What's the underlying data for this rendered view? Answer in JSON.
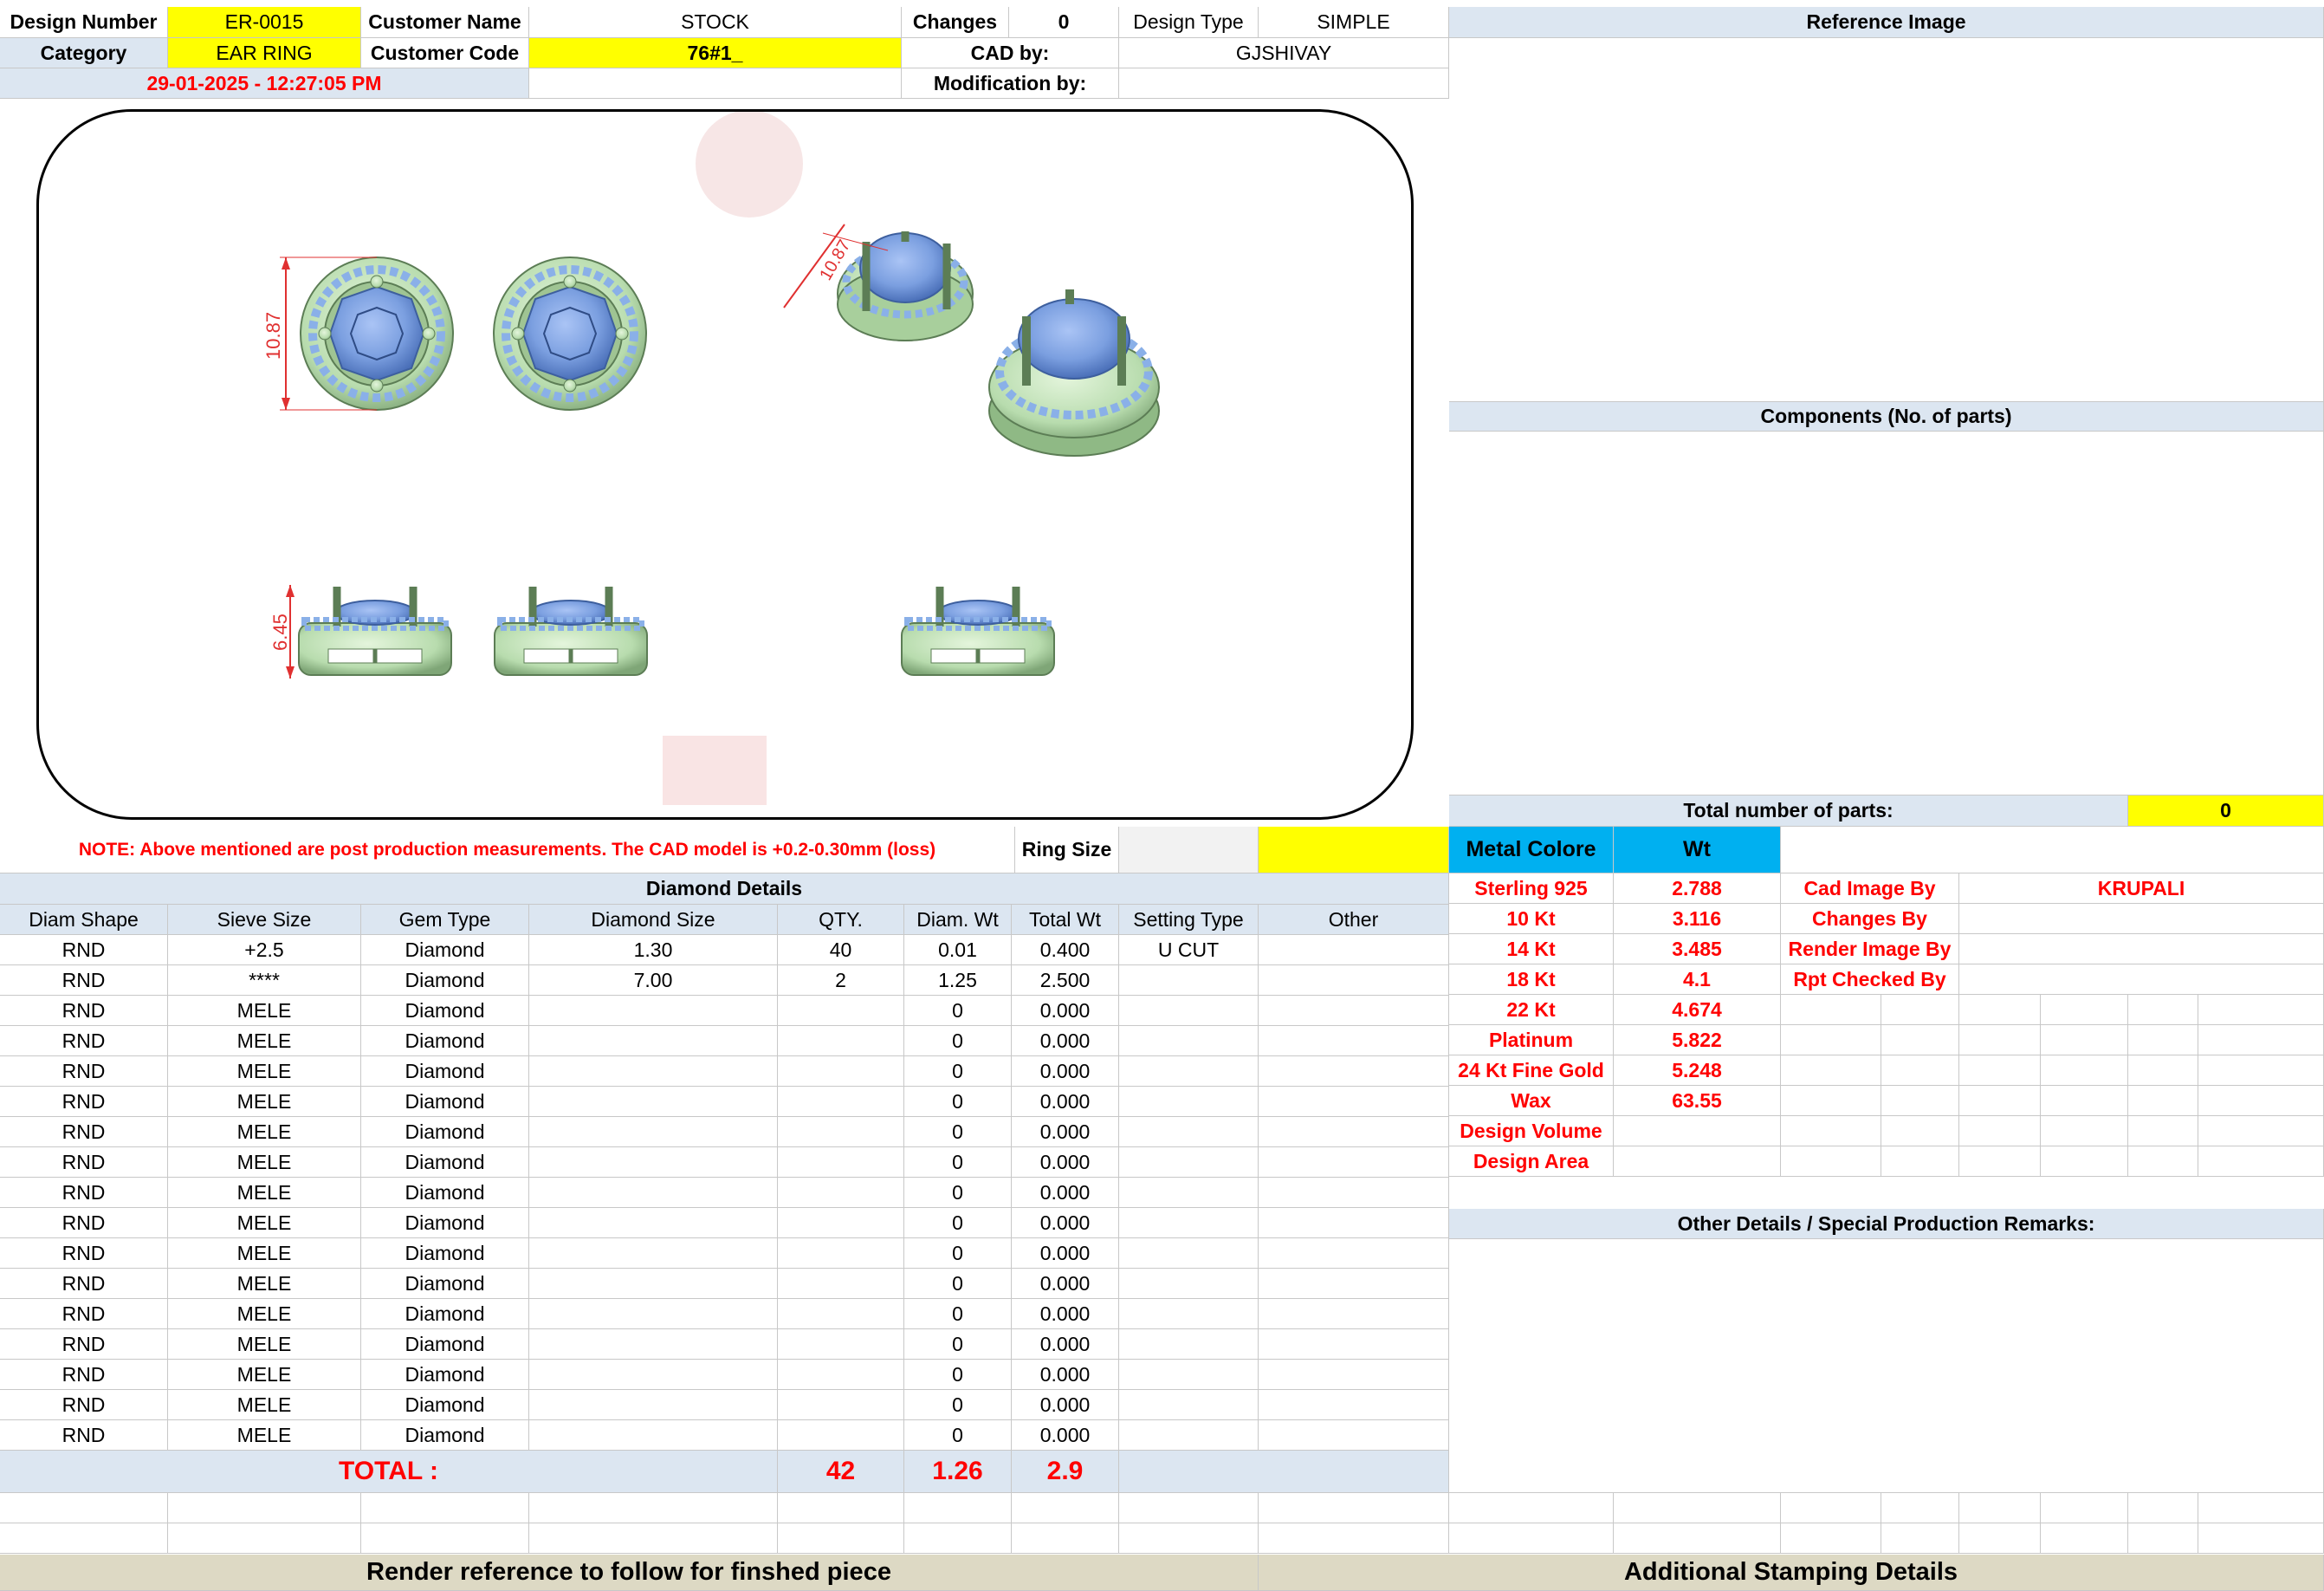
{
  "header": {
    "design_number_label": "Design Number",
    "design_number": "ER-0015",
    "customer_name_label": "Customer Name",
    "customer_name": "STOCK",
    "changes_label": "Changes",
    "changes": "0",
    "design_type_label": "Design Type",
    "design_type": "SIMPLE",
    "reference_image_label": "Reference Image",
    "category_label": "Category",
    "category": "EAR RING",
    "customer_code_label": "Customer Code",
    "customer_code": "76#1_",
    "cad_by_label": "CAD by:",
    "cad_by": "GJSHIVAY",
    "timestamp": "29-01-2025 - 12:27:05 PM",
    "modification_by_label": "Modification by:"
  },
  "drawing": {
    "dim_front": "10.87",
    "dim_side": "6.45",
    "dim_angle": "10.87"
  },
  "note": {
    "text": "NOTE: Above mentioned are post production measurements. The CAD model is +0.2-0.30mm (loss)",
    "ring_size_label": "Ring Size"
  },
  "colors": {
    "yellow": "#ffff00",
    "header_blue": "#dce6f1",
    "metal_blue": "#00b0f0",
    "red_text": "#ff0000",
    "metal_green": "#b8dcae",
    "gem_blue": "#7b9fe0"
  },
  "diamond": {
    "title": "Diamond Details",
    "columns": [
      "Diam Shape",
      "Sieve Size",
      "Gem Type",
      "Diamond Size",
      "QTY.",
      "Diam. Wt",
      "Total Wt",
      "Setting Type",
      "Other"
    ],
    "rows": [
      [
        "RND",
        "+2.5",
        "Diamond",
        "1.30",
        "40",
        "0.01",
        "0.400",
        "U CUT",
        ""
      ],
      [
        "RND",
        "****",
        "Diamond",
        "7.00",
        "2",
        "1.25",
        "2.500",
        "",
        ""
      ],
      [
        "RND",
        "MELE",
        "Diamond",
        "",
        "",
        "0",
        "0.000",
        "",
        ""
      ],
      [
        "RND",
        "MELE",
        "Diamond",
        "",
        "",
        "0",
        "0.000",
        "",
        ""
      ],
      [
        "RND",
        "MELE",
        "Diamond",
        "",
        "",
        "0",
        "0.000",
        "",
        ""
      ],
      [
        "RND",
        "MELE",
        "Diamond",
        "",
        "",
        "0",
        "0.000",
        "",
        ""
      ],
      [
        "RND",
        "MELE",
        "Diamond",
        "",
        "",
        "0",
        "0.000",
        "",
        ""
      ],
      [
        "RND",
        "MELE",
        "Diamond",
        "",
        "",
        "0",
        "0.000",
        "",
        ""
      ],
      [
        "RND",
        "MELE",
        "Diamond",
        "",
        "",
        "0",
        "0.000",
        "",
        ""
      ],
      [
        "RND",
        "MELE",
        "Diamond",
        "",
        "",
        "0",
        "0.000",
        "",
        ""
      ],
      [
        "RND",
        "MELE",
        "Diamond",
        "",
        "",
        "0",
        "0.000",
        "",
        ""
      ],
      [
        "RND",
        "MELE",
        "Diamond",
        "",
        "",
        "0",
        "0.000",
        "",
        ""
      ],
      [
        "RND",
        "MELE",
        "Diamond",
        "",
        "",
        "0",
        "0.000",
        "",
        ""
      ],
      [
        "RND",
        "MELE",
        "Diamond",
        "",
        "",
        "0",
        "0.000",
        "",
        ""
      ],
      [
        "RND",
        "MELE",
        "Diamond",
        "",
        "",
        "0",
        "0.000",
        "",
        ""
      ],
      [
        "RND",
        "MELE",
        "Diamond",
        "",
        "",
        "0",
        "0.000",
        "",
        ""
      ],
      [
        "RND",
        "MELE",
        "Diamond",
        "",
        "",
        "0",
        "0.000",
        "",
        ""
      ]
    ],
    "total_label": "TOTAL :",
    "total_qty": "42",
    "total_diam_wt": "1.26",
    "total_wt": "2.9"
  },
  "right": {
    "components_label": "Components (No. of parts)",
    "total_parts_label": "Total number of parts:",
    "total_parts": "0",
    "metal_label": "Metal Colore",
    "wt_label": "Wt",
    "metals": [
      {
        "name": "Sterling 925",
        "wt": "2.788"
      },
      {
        "name": "10 Kt",
        "wt": "3.116"
      },
      {
        "name": "14 Kt",
        "wt": "3.485"
      },
      {
        "name": "18 Kt",
        "wt": "4.1"
      },
      {
        "name": "22 Kt",
        "wt": "4.674"
      },
      {
        "name": "Platinum",
        "wt": "5.822"
      },
      {
        "name": "24 Kt Fine Gold",
        "wt": "5.248"
      },
      {
        "name": "Wax",
        "wt": "63.55"
      },
      {
        "name": "Design Volume",
        "wt": ""
      },
      {
        "name": "Design Area",
        "wt": ""
      }
    ],
    "people": [
      {
        "label": "Cad Image By",
        "value": "KRUPALI"
      },
      {
        "label": "Changes By",
        "value": ""
      },
      {
        "label": "Render Image By",
        "value": ""
      },
      {
        "label": "Rpt Checked By",
        "value": ""
      }
    ],
    "other_details_label": "Other Details / Special Production Remarks:"
  },
  "footer": {
    "render_label": "Render reference to follow for finshed piece",
    "stamping_label": "Additional Stamping Details"
  }
}
